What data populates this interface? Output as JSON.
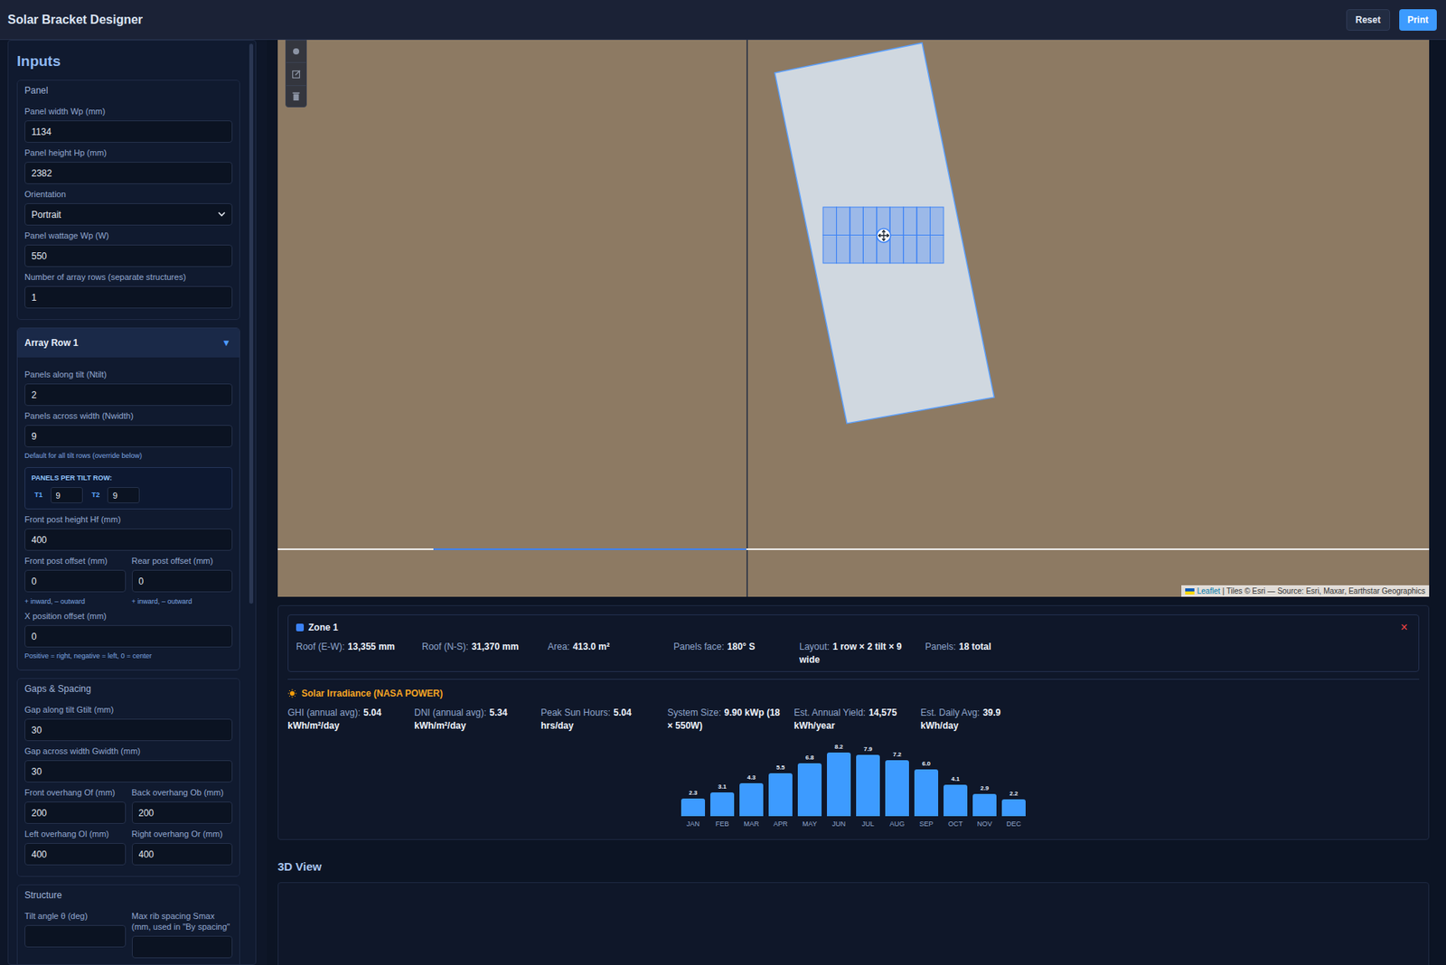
{
  "header": {
    "title": "Solar Bracket Designer",
    "buttons": [
      {
        "label": "Reset",
        "kind": "secondary"
      },
      {
        "label": "Print",
        "kind": "primary"
      }
    ]
  },
  "sidebar": {
    "title": "Inputs",
    "sections": [
      {
        "kind": "fieldset",
        "legend": "Panel",
        "rows": [
          {
            "kind": "field",
            "label": "Panel width Wp (mm)",
            "value": "1134"
          },
          {
            "kind": "field",
            "label": "Panel height Hp (mm)",
            "value": "2382"
          },
          {
            "kind": "select",
            "label": "Orientation",
            "value": "Portrait"
          },
          {
            "kind": "field",
            "label": "Panel wattage Wp (W)",
            "value": "550"
          },
          {
            "kind": "field",
            "label": "Number of array rows (separate structures)",
            "value": "1"
          }
        ]
      },
      {
        "kind": "collapsible",
        "legend": "Array Row 1",
        "toggle": "▼",
        "expanded": true,
        "rows": [
          {
            "kind": "field",
            "label": "Panels along tilt (Ntilt)",
            "value": "2"
          },
          {
            "kind": "field",
            "label": "Panels across width (Nwidth)",
            "value": "9"
          },
          {
            "kind": "hint",
            "text": "Default for all tilt rows (override below)"
          },
          {
            "kind": "tilt-box",
            "title": "PANELS PER TILT ROW:",
            "items": [
              {
                "label": "T1",
                "value": "9"
              },
              {
                "label": "T2",
                "value": "9"
              }
            ]
          },
          {
            "kind": "field",
            "label": "Front post height Hf (mm)",
            "value": "400"
          },
          {
            "kind": "pair",
            "fields": [
              {
                "label": "Front post offset (mm)",
                "value": "0",
                "hint": "+ inward, – outward"
              },
              {
                "label": "Rear post offset (mm)",
                "value": "0",
                "hint": "+ inward, – outward"
              }
            ]
          },
          {
            "kind": "field",
            "label": "X position offset (mm)",
            "value": "0"
          },
          {
            "kind": "hint",
            "text": "Positive = right, negative = left, 0 = center"
          }
        ]
      },
      {
        "kind": "fieldset",
        "legend": "Gaps & Spacing",
        "rows": [
          {
            "kind": "field",
            "label": "Gap along tilt Gtilt (mm)",
            "value": "30"
          },
          {
            "kind": "field",
            "label": "Gap across width Gwidth (mm)",
            "value": "30"
          },
          {
            "kind": "pair",
            "fields": [
              {
                "label": "Front overhang Of (mm)",
                "value": "200"
              },
              {
                "label": "Back overhang Ob (mm)",
                "value": "200"
              }
            ]
          },
          {
            "kind": "pair",
            "fields": [
              {
                "label": "Left overhang Ol (mm)",
                "value": "400"
              },
              {
                "label": "Right overhang Or (mm)",
                "value": "400"
              }
            ]
          }
        ]
      },
      {
        "kind": "fieldset",
        "legend": "Structure",
        "rows": [
          {
            "kind": "pair",
            "fields": [
              {
                "label": "Tilt angle θ (deg)"
              },
              {
                "label": "Max rib spacing Smax (mm, used in \"By spacing\""
              }
            ]
          }
        ]
      }
    ]
  },
  "map": {
    "panel_grid": {
      "rows": 2,
      "columns": 9
    },
    "attribution": {
      "link": "Leaflet",
      "text": "| Tiles © Esri — Source: Esri, Maxar, Earthstar Geographics"
    }
  },
  "zone": {
    "name": "Zone 1",
    "color": "#3b82f6",
    "close": "×",
    "stats": [
      {
        "label": "Roof (E-W):",
        "value": "13,355 mm"
      },
      {
        "label": "Roof (N-S):",
        "value": "31,370 mm"
      },
      {
        "label": "Area:",
        "value": "413.0 m²"
      },
      {
        "label": "Panels face:",
        "value": "180° S"
      },
      {
        "label": "Layout:",
        "value": "1 row × 2 tilt × 9 wide"
      },
      {
        "label": "Panels:",
        "value": "18 total"
      }
    ]
  },
  "irradiance": {
    "title": "Solar Irradiance (NASA POWER)",
    "stats": [
      {
        "label": "GHI (annual avg):",
        "value": "5.04 kWh/m²/day"
      },
      {
        "label": "DNI (annual avg):",
        "value": "5.34 kWh/m²/day"
      },
      {
        "label": "Peak Sun Hours:",
        "value": "5.04 hrs/day"
      },
      {
        "label": "System Size:",
        "value": "9.90 kWp (18 × 550W)"
      },
      {
        "label": "Est. Annual Yield:",
        "value": "14,575 kWh/year"
      },
      {
        "label": "Est. Daily Avg:",
        "value": "39.9 kWh/day"
      }
    ],
    "chart": {
      "months": [
        "JAN",
        "FEB",
        "MAR",
        "APR",
        "MAY",
        "JUN",
        "JUL",
        "AUG",
        "SEP",
        "OCT",
        "NOV",
        "DEC"
      ],
      "values": [
        2.3,
        3.1,
        4.3,
        5.5,
        6.8,
        8.2,
        7.9,
        7.2,
        6.0,
        4.1,
        2.9,
        2.2
      ],
      "labels": [
        "2.3",
        "3.1",
        "4.3",
        "5.5",
        "6.8",
        "8.2",
        "7.9",
        "7.2",
        "6.0",
        "4.1",
        "2.9",
        "2.2"
      ]
    }
  },
  "view3d": {
    "title": "3D View"
  }
}
